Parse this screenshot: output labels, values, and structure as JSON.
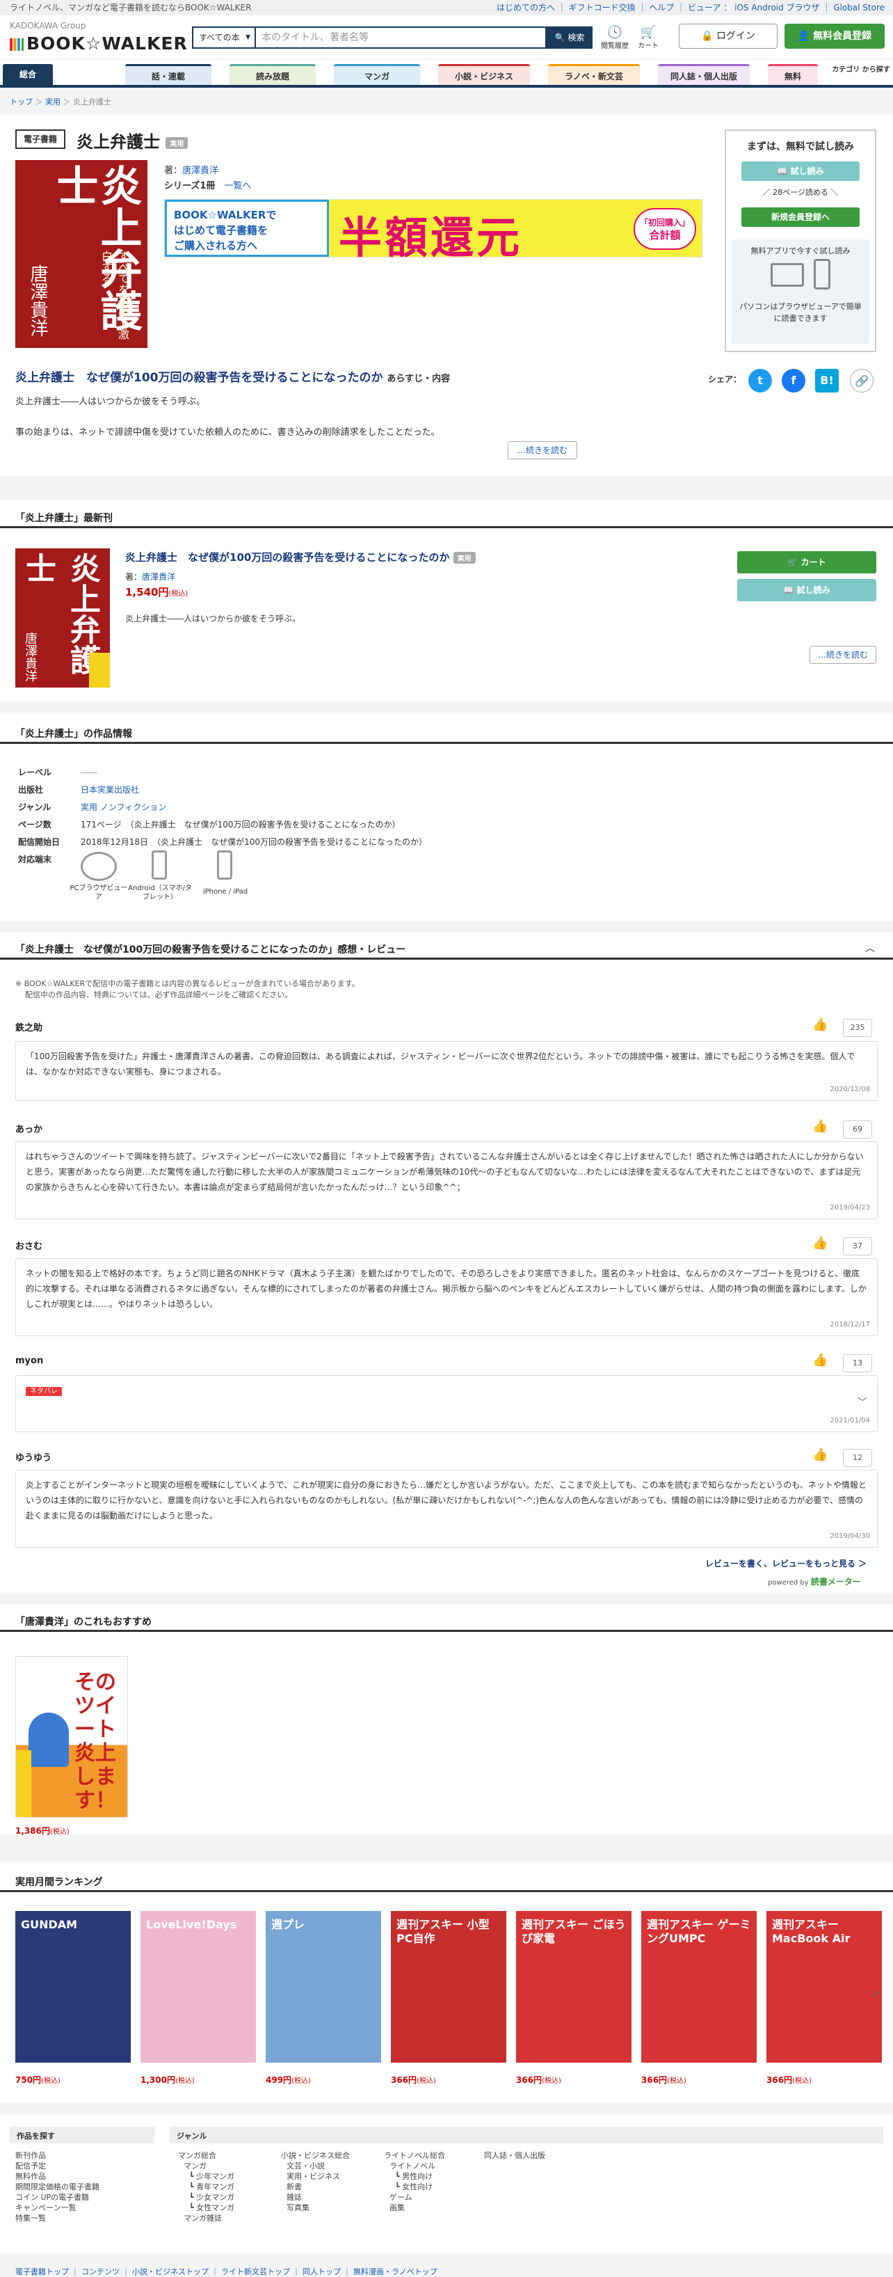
{
  "topbar": {
    "left": "ライトノベル、マンガなど電子書籍を読むならBOOK☆WALKER",
    "right_links": [
      "はじめての方へ",
      "ギフトコード交換",
      "ヘルプ",
      "ビューア",
      "iOS Android ブラウザ",
      "Global Store"
    ]
  },
  "header": {
    "logo_group": "KADOKAWA Group",
    "logo": "BOOK☆WALKER",
    "search_category": "すべての本",
    "search_placeholder": "本のタイトル、著者名等",
    "search_button": "検索",
    "history": "閲覧履歴",
    "cart": "カート",
    "login": "ログイン",
    "register": "無料会員登録"
  },
  "nav": {
    "items": [
      "総合",
      "話・連載",
      "読み放題",
      "マンガ",
      "小説・ビジネス",
      "ラノベ・新文芸",
      "同人誌・個人出版",
      "無料",
      "カテゴリ から探す"
    ]
  },
  "breadcrumb": [
    "トップ",
    "実用",
    "炎上弁護士"
  ],
  "product": {
    "badge": "電子書籍",
    "title": "炎上弁護士",
    "tag": "実用",
    "author_label": "著：",
    "author": "唐澤貴洋",
    "series_label": "シリーズ1冊",
    "series_link": "一覧へ",
    "cover_title": "炎上弁護士",
    "cover_author": "唐澤貴洋",
    "cover_sub": "すべてを初めて激白する",
    "subtitle": "炎上弁護士　なぜ僕が100万回の殺害予告を受けることになったのか",
    "subtitle_suffix": "あらすじ・内容",
    "desc1": "炎上弁護士――人はいつからか彼をそう呼ぶ。",
    "desc2": "事の始まりは、ネットで誹謗中傷を受けていた依頼人のために、書き込みの削除請求をしたことだった。",
    "read_more": "…続きを読む",
    "share_label": "シェア："
  },
  "banner": {
    "line1": "BOOK☆WALKERで",
    "line2": "はじめて電子書籍を",
    "line3": "ご購入される方へ",
    "big": "半額還元",
    "badge1": "「初回購入」",
    "badge2": "合計額"
  },
  "side": {
    "heading": "まずは、無料で試し読み",
    "trial_btn": "試し読み",
    "pages": "／ 28ページ読める ＼",
    "reg_btn": "新規会員登録へ",
    "app_text": "無料アプリで今すぐ試し読み",
    "pc_text": "パソコンはブラウザビューアで簡単に読書できます"
  },
  "latest": {
    "heading": "「炎上弁護士」最新刊",
    "title": "炎上弁護士　なぜ僕が100万回の殺害予告を受けることになったのか",
    "tag": "実用",
    "author_label": "著：",
    "author": "唐澤貴洋",
    "price": "1,540円",
    "tax": "(税込)",
    "desc": "炎上弁護士――人はいつからか彼をそう呼ぶ。",
    "cart_btn": "カート",
    "trial_btn": "試し読み",
    "read_more": "…続きを読む"
  },
  "info": {
    "heading": "「炎上弁護士」の作品情報",
    "rows": [
      {
        "label": "レーベル",
        "value": "――"
      },
      {
        "label": "出版社",
        "value": "日本実業出版社"
      },
      {
        "label": "ジャンル",
        "value": "実用 ノンフィクション"
      },
      {
        "label": "ページ数",
        "value": "171ページ　（炎上弁護士　なぜ僕が100万回の殺害予告を受けることになったのか）"
      },
      {
        "label": "配信開始日",
        "value": "2018年12月18日　（炎上弁護士　なぜ僕が100万回の殺害予告を受けることになったのか）"
      },
      {
        "label": "対応端末",
        "value": ""
      }
    ],
    "devices": [
      "PCブラウザビューア",
      "Android（スマホ/タブレット）",
      "iPhone / iPad"
    ]
  },
  "reviews": {
    "heading": "「炎上弁護士　なぜ僕が100万回の殺害予告を受けることになったのか」感想・レビュー",
    "note1": "※ BOOK☆WALKERで配信中の電子書籍とは内容の異なるレビューが含まれている場合があります。",
    "note2": "配信中の作品内容、特典については、必ず作品詳細ページをご確認ください。",
    "items": [
      {
        "name": "鉄之助",
        "likes": "235",
        "text": "「100万回殺害予告を受けた」弁護士・唐澤貴洋さんの著書。この脅迫回数は、ある調査によれば、ジャスティン・ビーバーに次ぐ世界2位だという。ネットでの誹謗中傷・被害は、誰にでも起こりうる怖さを実感。個人では、なかなか対応できない実態も、身につまされる。",
        "date": "2020/12/08"
      },
      {
        "name": "あっか",
        "likes": "69",
        "text": "はれちゃうさんのツイートで興味を持ち読了。ジャスティンビーバーに次いで2番目に「ネット上で殺害予告」されているこんな弁護士さんがいるとは全く存じ上げませんでした！晒された怖さは晒された人にしか分からないと思う。実害があったなら尚更…ただ驚愕を通した行動に移した大半の人が家族間コミュニケーションが希薄気味の10代〜の子どもなんて切ないな…わたしには法律を変えるなんて大それたことはできないので、まずは足元の家族からきちんと心を砕いて行きたい。本書は論点が定まらず結局何が言いたかったんだっけ…？という印象^^；",
        "date": "2019/04/23"
      },
      {
        "name": "おさむ",
        "likes": "37",
        "text": "ネットの闇を知る上で格好の本です。ちょうど同じ題名のNHKドラマ（真木よう子主演）を観たばかりでしたので、その恐ろしさをより実感できました。匿名のネット社会は、なんらかのスケープゴートを見つけると、徹底的に攻撃する。それは単なる消費されるネタに過ぎない。そんな標的にされてしまったのが著者の弁護士さん。掲示板から脳へのペンキをどんどんエスカレートしていく嫌がらせは、人間の持つ負の側面を露わにします。しかしこれが現実とは……。やはりネットは恐ろしい。",
        "date": "2018/12/17"
      },
      {
        "name": "myon",
        "likes": "13",
        "text": "ネタバレ",
        "date": "2021/01/04",
        "spoiler": true
      },
      {
        "name": "ゆうゆう",
        "likes": "12",
        "text": "炎上することがインターネットと現実の垣根を曖昧にしていくようで、これが現実に自分の身におきたら…嫌だとしか言いようがない。ただ、ここまで炎上しても、この本を読むまで知らなかったというのも、ネットや情報というのは主体的に取りに行かないと、意識を向けないと手に入れられないものなのかもしれない。(私が単に疎いだけかもしれない(^-^;)色んな人の色んな言いがあっても、情報の前には冷静に受け止める力が必要で、感情の赴くままに見るのは脳動画だけにしようと思った。",
        "date": "2019/04/30"
      }
    ],
    "more": "レビューを書く、レビューをもっと見る ＞",
    "powered": "powered by",
    "meter": "読書メーター"
  },
  "reco": {
    "heading": "「唐澤貴洋」のこれもおすすめ",
    "cover_text": "そのツイート炎上します！",
    "price": "1,386円",
    "tax": "(税込)"
  },
  "ranking": {
    "heading": "実用月間ランキング",
    "items": [
      {
        "title": "GUNDAM",
        "price": "750円",
        "color": "#2a3a7a"
      },
      {
        "title": "LoveLive!Days",
        "price": "1,300円",
        "color": "#f0b8d0"
      },
      {
        "title": "週プレ",
        "price": "499円",
        "color": "#7aa6d6"
      },
      {
        "title": "週刊アスキー 小型PC自作",
        "price": "366円",
        "color": "#c62e2e"
      },
      {
        "title": "週刊アスキー ごほうび家電",
        "price": "366円",
        "color": "#d63434"
      },
      {
        "title": "週刊アスキー ゲーミングUMPC",
        "price": "366円",
        "color": "#d63434"
      },
      {
        "title": "週刊アスキー MacBook Air",
        "price": "366円",
        "color": "#d63434"
      }
    ],
    "tax": "(税込)"
  },
  "footer": {
    "col1_head": "作品を探す",
    "col1": [
      "新刊作品",
      "配信予定",
      "無料作品",
      "期間限定価格の電子書籍",
      "コイン UPの電子書籍",
      "キャンペーン一覧",
      "特集一覧"
    ],
    "col2_head": "ジャンル",
    "col2a": [
      "マンガ総合",
      "マンガ",
      "┗ 少年マンガ",
      "┗ 青年マンガ",
      "┗ 少女マンガ",
      "┗ 女性マンガ",
      "マンガ雑誌"
    ],
    "col2b": [
      "小説・ビジネス総合",
      "文芸・小説",
      "実用・ビジネス",
      "新書",
      "雑誌",
      "写真集"
    ],
    "col2c": [
      "ライトノベル総合",
      "ライトノベル",
      "┗ 男性向け",
      "┗ 女性向け",
      "ゲーム",
      "画集"
    ],
    "col2d": [
      "同人誌・個人出版"
    ],
    "bottom": "電子書籍トップ ｜ コンテンツ ｜ 小説・ビジネストップ ｜ ライト新文芸トップ ｜ 同人トップ ｜ 無料漫画・ラノベトップ"
  }
}
